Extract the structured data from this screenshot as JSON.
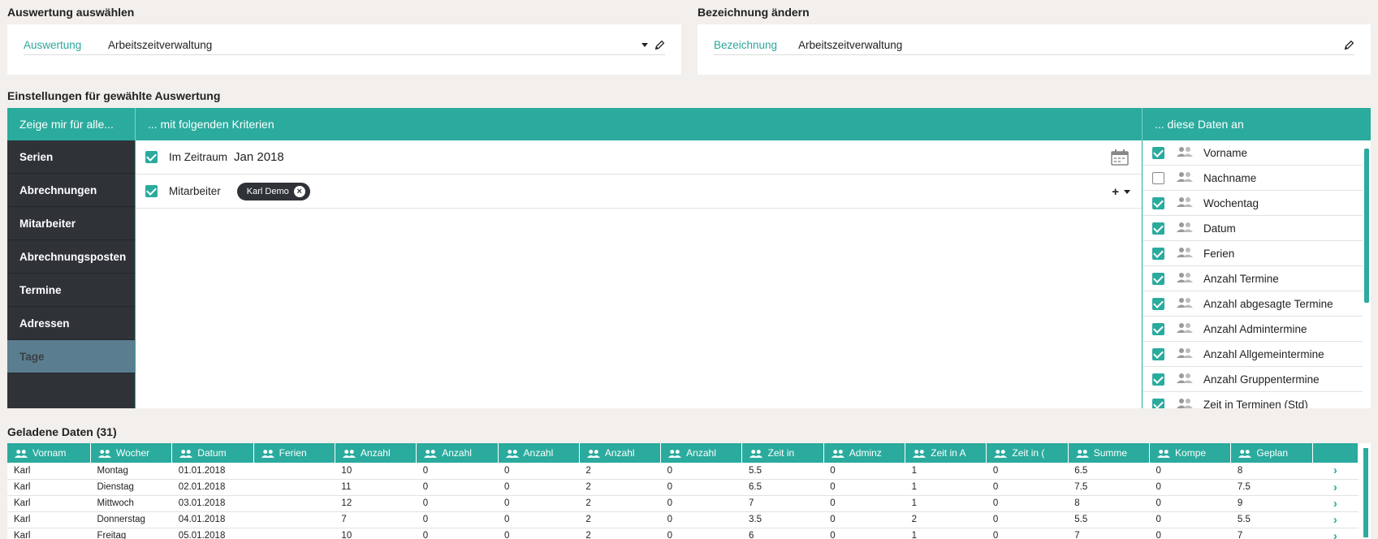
{
  "select_section": {
    "title": "Auswertung auswählen",
    "label": "Auswertung",
    "value": "Arbeitszeitverwaltung"
  },
  "rename_section": {
    "title": "Bezeichnung ändern",
    "label": "Bezeichnung",
    "value": "Arbeitszeitverwaltung"
  },
  "settings": {
    "title": "Einstellungen für gewählte Auswertung",
    "col1_header": "Zeige mir für alle...",
    "col2_header": "... mit folgenden Kriterien",
    "col3_header": "... diese Daten an",
    "nav": [
      {
        "label": "Serien",
        "active": false
      },
      {
        "label": "Abrechnungen",
        "active": false
      },
      {
        "label": "Mitarbeiter",
        "active": false
      },
      {
        "label": "Abrechnungsposten",
        "active": false
      },
      {
        "label": "Termine",
        "active": false
      },
      {
        "label": "Adressen",
        "active": false
      },
      {
        "label": "Tage",
        "active": true
      }
    ],
    "criteria": {
      "period": {
        "label": "Im Zeitraum",
        "value": "Jan 2018",
        "checked": true
      },
      "employee": {
        "label": "Mitarbeiter",
        "chip": "Karl Demo",
        "checked": true
      }
    },
    "fields": [
      {
        "label": "Vorname",
        "checked": true
      },
      {
        "label": "Nachname",
        "checked": false
      },
      {
        "label": "Wochentag",
        "checked": true
      },
      {
        "label": "Datum",
        "checked": true
      },
      {
        "label": "Ferien",
        "checked": true
      },
      {
        "label": "Anzahl Termine",
        "checked": true
      },
      {
        "label": "Anzahl abgesagte Termine",
        "checked": true
      },
      {
        "label": "Anzahl Admintermine",
        "checked": true
      },
      {
        "label": "Anzahl Allgemeintermine",
        "checked": true
      },
      {
        "label": "Anzahl Gruppentermine",
        "checked": true
      },
      {
        "label": "Zeit in Terminen (Std)",
        "checked": true
      }
    ]
  },
  "loaded": {
    "title": "Geladene Daten (31)",
    "columns": [
      "Vornam",
      "Wocher",
      "Datum",
      "Ferien",
      "Anzahl",
      "Anzahl",
      "Anzahl",
      "Anzahl",
      "Anzahl",
      "Zeit in ",
      "Adminz",
      "Zeit in A",
      "Zeit in (",
      "Summe",
      "Kompe",
      "Geplan"
    ],
    "rows": [
      [
        "Karl",
        "Montag",
        "01.01.2018",
        "",
        "10",
        "0",
        "0",
        "2",
        "0",
        "5.5",
        "0",
        "1",
        "0",
        "6.5",
        "0",
        "8"
      ],
      [
        "Karl",
        "Dienstag",
        "02.01.2018",
        "",
        "11",
        "0",
        "0",
        "2",
        "0",
        "6.5",
        "0",
        "1",
        "0",
        "7.5",
        "0",
        "7.5"
      ],
      [
        "Karl",
        "Mittwoch",
        "03.01.2018",
        "",
        "12",
        "0",
        "0",
        "2",
        "0",
        "7",
        "0",
        "1",
        "0",
        "8",
        "0",
        "9"
      ],
      [
        "Karl",
        "Donnerstag",
        "04.01.2018",
        "",
        "7",
        "0",
        "0",
        "2",
        "0",
        "3.5",
        "0",
        "2",
        "0",
        "5.5",
        "0",
        "5.5"
      ],
      [
        "Karl",
        "Freitag",
        "05.01.2018",
        "",
        "10",
        "0",
        "0",
        "2",
        "0",
        "6",
        "0",
        "1",
        "0",
        "7",
        "0",
        "7"
      ]
    ]
  }
}
